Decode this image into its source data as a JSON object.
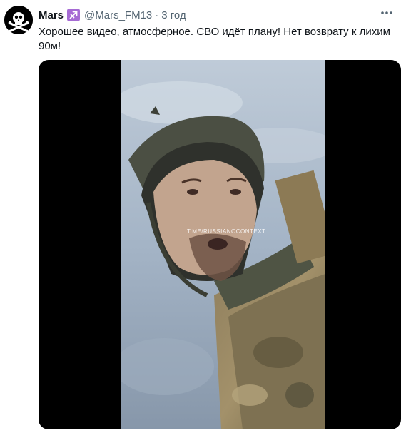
{
  "tweet": {
    "author_name": "Mars",
    "author_badge_icon": "sagittarius-icon",
    "author_handle": "@Mars_FM13",
    "separator": "·",
    "timestamp": "3 год",
    "text": "Хорошее видео, атмосферное. СВО идёт плану! Нет возврату к лихим 90м!",
    "more_icon": "more-icon"
  },
  "media": {
    "type": "video",
    "watermark": "T.ME/RUSSIANOCONTEXT"
  },
  "colors": {
    "text": "#0f1419",
    "secondary": "#536471",
    "badge": "#a66bd4",
    "media_bg": "#000000"
  }
}
